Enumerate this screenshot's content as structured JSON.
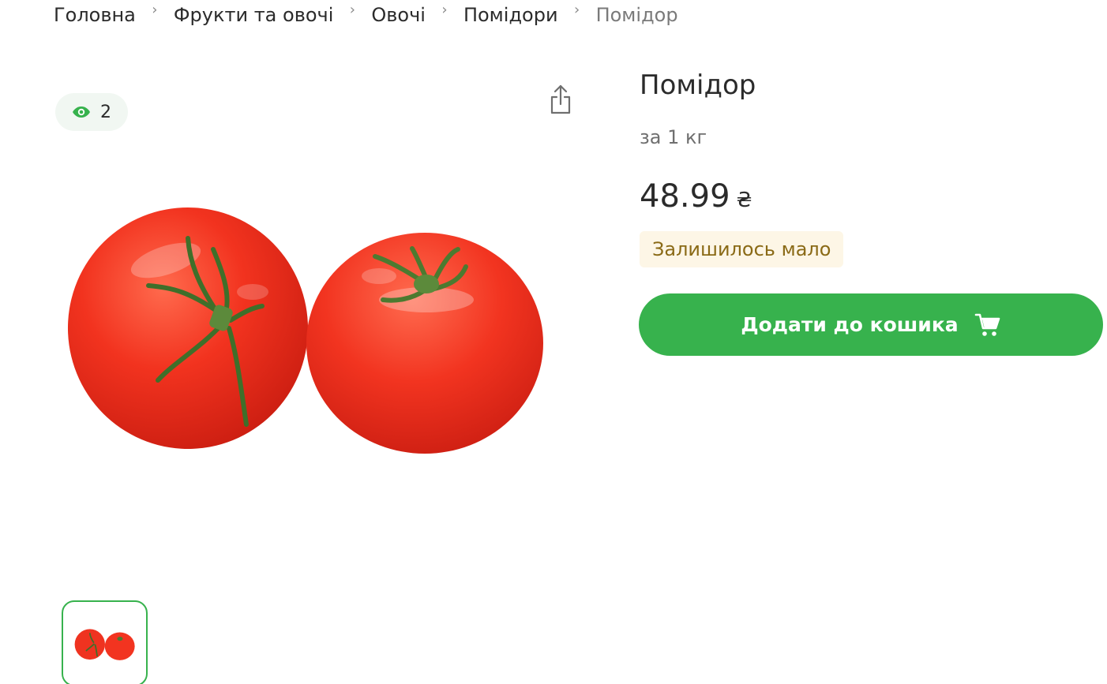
{
  "breadcrumb": {
    "items": [
      {
        "label": "Головна"
      },
      {
        "label": "Фрукти та овочі"
      },
      {
        "label": "Овочі"
      },
      {
        "label": "Помідори"
      },
      {
        "label": "Помідор"
      }
    ],
    "separator": "›"
  },
  "gallery": {
    "views_count": "2",
    "views_icon": "eye-icon",
    "share_icon": "share-icon",
    "thumbnail_count": 1
  },
  "product": {
    "title": "Помідор",
    "unit": "за 1 кг",
    "price": "48.99",
    "currency": "₴",
    "stock_status": "Залишилось мало",
    "add_to_cart_label": "Додати до кошика",
    "cart_icon": "cart-icon"
  },
  "colors": {
    "accent_green": "#37b24d",
    "stock_badge_bg": "#fdf6e6",
    "stock_badge_text": "#8a6a16",
    "views_badge_bg": "#f1f7f2"
  }
}
